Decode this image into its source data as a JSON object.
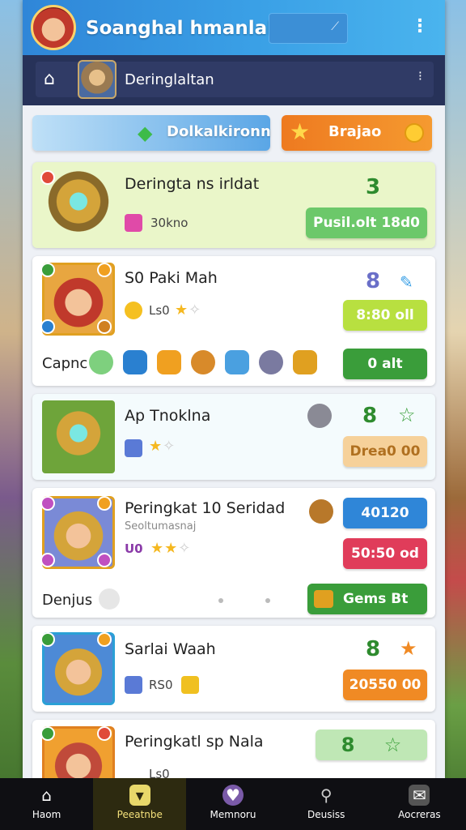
{
  "header": {
    "title": "Soanghal hmanlali",
    "avatar_icon": "hero-avatar-icon",
    "search_icon": "search-icon",
    "menu_icon": "kebab-menu-icon"
  },
  "nav": {
    "label": "Deringlaltan",
    "home_icon": "home-icon",
    "more_icon": "more-icon"
  },
  "tabs": [
    {
      "label": "Dolkalkironn",
      "icon": "gem-icon",
      "color": "#5aa6e6"
    },
    {
      "label": "Brajao",
      "icon": "star-icon",
      "color": "#f08524"
    }
  ],
  "cards": [
    {
      "title": "Deringta ns irldat",
      "sub": "30kno",
      "number": "3",
      "button": "Pusil.olt 18d0",
      "number_color": "#2e8b2e",
      "button_color": "#6cc86a"
    },
    {
      "title": "S0 Paki Mah",
      "sub": "Ls0",
      "number": "8",
      "button_top": "8:80 oll",
      "button_bottom": "0 alt",
      "row_label": "Capnc",
      "number_color": "#6a6fc8",
      "button_top_color": "#b8e040",
      "button_bottom_color": "#3a9d3a"
    },
    {
      "title": "Ap Tnoklna",
      "number": "8",
      "button": "Drea0 00",
      "number_color": "#2e8b2e",
      "button_color": "#f6d19a"
    },
    {
      "title": "Peringkat 10 Seridad",
      "subtitle": "Seoltumasnaj",
      "sub": "U0",
      "button_top": "40120",
      "button_mid": "50:50 od",
      "button_bottom": "Gems Bt",
      "row_label": "Denjus",
      "button_top_color": "#2f86d8",
      "button_mid_color": "#e03c5a",
      "button_bottom_color": "#3a9d3a"
    },
    {
      "title": "Sarlai Waah",
      "sub": "RS0",
      "number": "8",
      "button": "20550 00",
      "number_color": "#2e8b2e",
      "button_color": "#f08a24"
    },
    {
      "title": "Peringkatl sp Nala",
      "sub": "Ls0",
      "number": "8",
      "number_color": "#2e8b2e",
      "button_color": "#bfe7b5"
    }
  ],
  "bottom_nav": [
    {
      "label": "Haom",
      "icon": "home-icon"
    },
    {
      "label": "Peeatnbe",
      "icon": "shield-icon",
      "active": true
    },
    {
      "label": "Memnoru",
      "icon": "heart-icon"
    },
    {
      "label": "Deusiss",
      "icon": "search-icon"
    },
    {
      "label": "Aocreras",
      "icon": "inbox-icon"
    }
  ]
}
